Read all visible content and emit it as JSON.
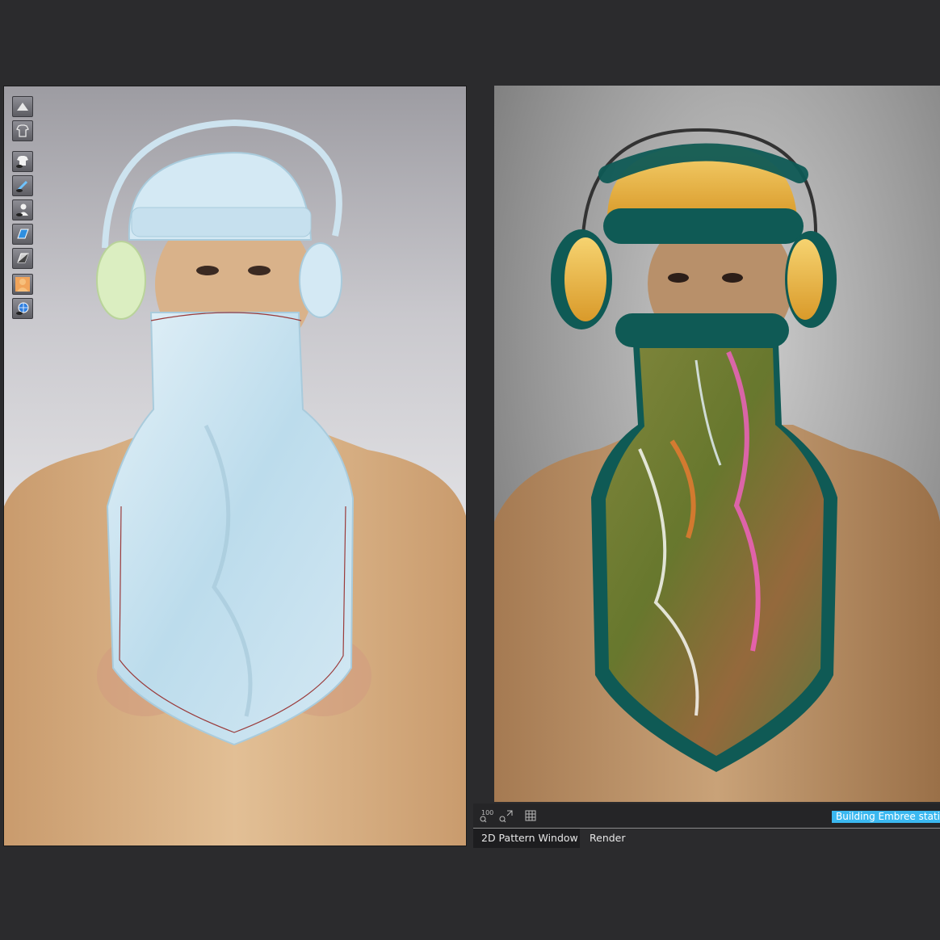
{
  "toolbar": {
    "tools": [
      {
        "icon": "avatar-display-icon"
      },
      {
        "icon": "garment-display-icon"
      },
      {
        "icon": "show-garment-icon"
      },
      {
        "icon": "show-pins-icon"
      },
      {
        "icon": "show-avatar-icon"
      },
      {
        "icon": "texture-view-icon"
      },
      {
        "icon": "shaded-view-icon"
      },
      {
        "icon": "avatar-skin-icon"
      },
      {
        "icon": "environment-globe-icon"
      }
    ]
  },
  "render_toolbar": {
    "zoom_100_label": "100",
    "status_text": "Building Embree static"
  },
  "tabs": [
    {
      "label": "2D Pattern Window"
    },
    {
      "label": "Render"
    }
  ],
  "colors": {
    "ui_background": "#2b2b2d",
    "status_highlight": "#3bb8f0",
    "garment_simulation": "#cfe6f2",
    "fur_trim": "#0f5a55",
    "earmuff_yellow": "#e3ab3a",
    "earmuff_green": "#dbeec1"
  }
}
